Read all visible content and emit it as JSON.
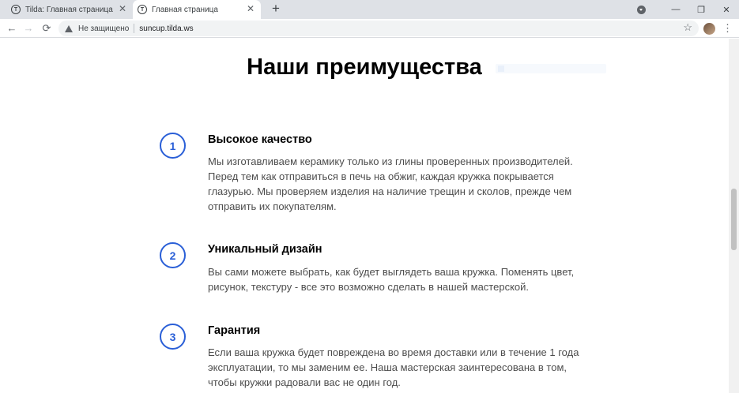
{
  "browser": {
    "tabs": [
      {
        "title": "Tilda: Главная страница",
        "active": false
      },
      {
        "title": "Главная страница",
        "active": true
      }
    ],
    "new_tab": "+",
    "window_controls": {
      "minimize": "—",
      "restore": "❐",
      "close": "✕"
    },
    "nav": {
      "back": "←",
      "forward": "→",
      "reload": "⟳"
    },
    "security_label": "Не защищено",
    "url": "suncup.tilda.ws",
    "bookmark_star": "☆",
    "menu": "⋮"
  },
  "page": {
    "section_title": "Наши преимущества",
    "features": [
      {
        "number": "1",
        "title": "Высокое качество",
        "lines": [
          "Мы изготавливаем керамику только из глины проверенных производителей.",
          "Перед тем как отправиться в печь на обжиг, каждая кружка покрывается",
          "глазурью. Мы проверяем изделия на наличие трещин и сколов, прежде чем",
          "отправить их покупателям."
        ]
      },
      {
        "number": "2",
        "title": "Уникальный дизайн",
        "lines": [
          "Вы сами можете выбрать, как будет выглядеть ваша кружка. Поменять цвет,",
          "рисунок, текстуру - все это возможно сделать в нашей мастерской."
        ]
      },
      {
        "number": "3",
        "title": "Гарантия",
        "lines": [
          "Если ваша кружка будет повреждена во время доставки или в течение 1 года",
          "эксплуатации, то мы заменим ее. Наша мастерская заинтересована в том,",
          "чтобы кружки радовали вас не один год."
        ]
      }
    ]
  },
  "colors": {
    "accent": "#2a5fd7",
    "body_text": "#4d4d4d",
    "heading": "#000000"
  }
}
